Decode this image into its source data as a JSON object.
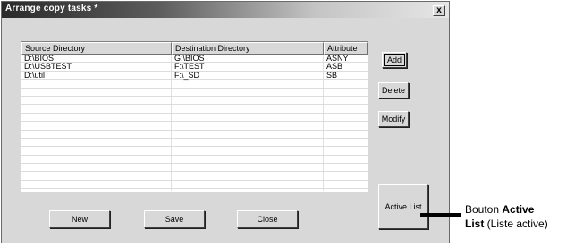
{
  "window": {
    "title": "Arrange copy tasks *",
    "close_label": "x"
  },
  "table": {
    "columns": [
      "Source Directory",
      "Destination Directory",
      "Attribute"
    ],
    "rows": [
      [
        "D:\\BIOS",
        "G:\\BIOS",
        "ASNY"
      ],
      [
        "D:\\USBTEST",
        "F:\\TEST",
        "ASB"
      ],
      [
        "D:\\util",
        "F:\\_SD",
        "SB"
      ],
      [
        "",
        "",
        ""
      ],
      [
        "",
        "",
        ""
      ],
      [
        "",
        "",
        ""
      ],
      [
        "",
        "",
        ""
      ],
      [
        "",
        "",
        ""
      ],
      [
        "",
        "",
        ""
      ],
      [
        "",
        "",
        ""
      ],
      [
        "",
        "",
        ""
      ],
      [
        "",
        "",
        ""
      ],
      [
        "",
        "",
        ""
      ],
      [
        "",
        "",
        ""
      ],
      [
        "",
        "",
        ""
      ],
      [
        "",
        "",
        ""
      ]
    ]
  },
  "buttons": {
    "add": "Add",
    "delete": "Delete",
    "modify": "Modify",
    "active_list": "Active List",
    "new": "New",
    "save": "Save",
    "close": "Close"
  },
  "annotation": {
    "part1": "Bouton ",
    "bold1": "Active",
    "bold2": "List",
    "part2": " (Liste active)"
  }
}
